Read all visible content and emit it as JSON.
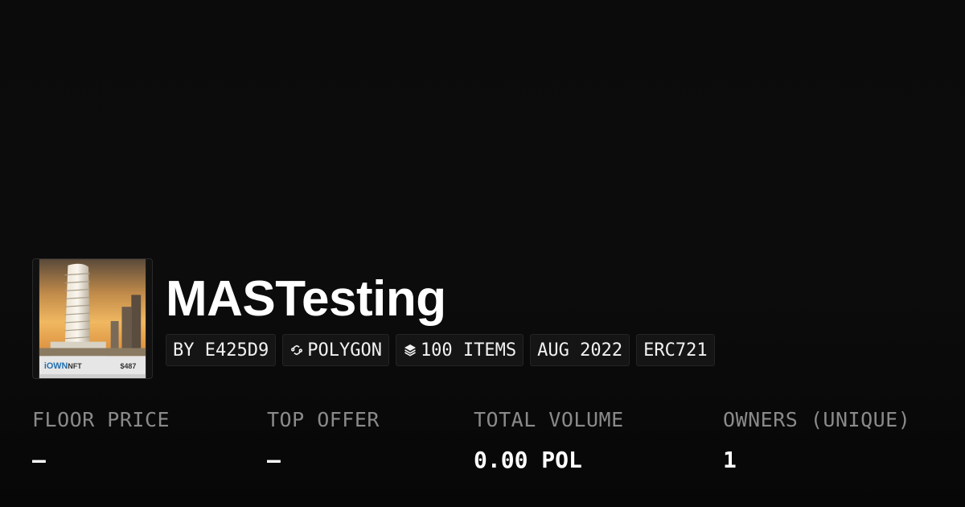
{
  "collection": {
    "name": "MASTesting",
    "thumbnail": {
      "icon": "building-image",
      "brand_text": "iOWN",
      "brand_suffix": "NFT",
      "price_text": "$487"
    }
  },
  "chips": {
    "creator": "BY E425D9",
    "chain": {
      "icon": "polygon-icon",
      "label": "POLYGON"
    },
    "items": {
      "icon": "layers-icon",
      "label": "100 ITEMS"
    },
    "date": "AUG 2022",
    "standard": "ERC721"
  },
  "stats": {
    "floor_price": {
      "label": "FLOOR PRICE",
      "value": "–"
    },
    "top_offer": {
      "label": "TOP OFFER",
      "value": "–"
    },
    "total_volume": {
      "label": "TOTAL VOLUME",
      "value": "0.00 POL"
    },
    "owners": {
      "label": "OWNERS (UNIQUE)",
      "value": "1"
    }
  },
  "colors": {
    "background": "#0a0a0a",
    "chip_background": "#151515",
    "label_gray": "#8a8a8a",
    "text": "#ffffff"
  }
}
